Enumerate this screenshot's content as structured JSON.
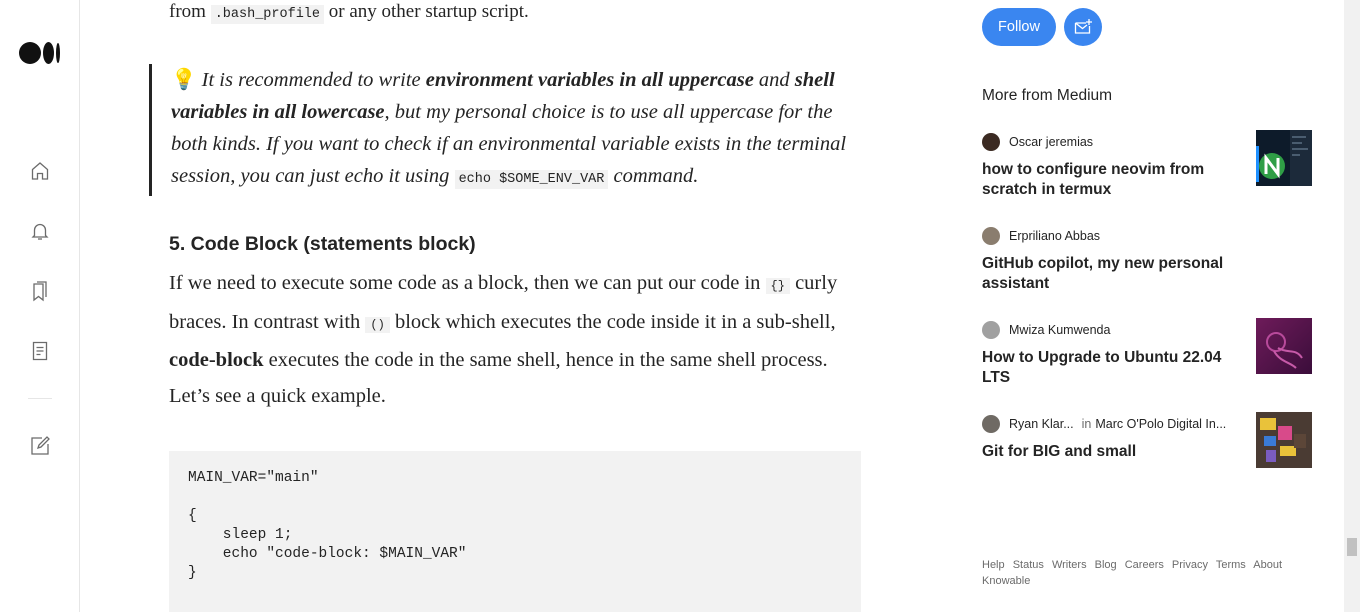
{
  "article": {
    "p_top_before": "from ",
    "p_top_code": ".bash_profile",
    "p_top_after": " or any other startup script.",
    "quote": {
      "bulb": "💡",
      "t1": " It is recommended to write ",
      "b1": "environment variables in all uppercase",
      "t2": " and ",
      "b2": "shell variables in all lowercase",
      "t3": ", but my personal choice is to use all uppercase for the both kinds. If you want to check if an environmental variable exists in the terminal session, you can just echo it using ",
      "code": "echo $SOME_ENV_VAR",
      "t4": " command."
    },
    "heading": "5. Code Block (statements block)",
    "para": {
      "t1": "If we need to execute some code as a block, then we can put our code in ",
      "c1": "{}",
      "t2": " curly braces. In contrast with ",
      "c2": "()",
      "t3": " block which executes the code inside it in a sub-shell, ",
      "b1": "code-block",
      "t4": " executes the code in the same shell, hence in the same shell process. Let’s see a quick example."
    },
    "code_block": "MAIN_VAR=\"main\"\n\n{\n    sleep 1;\n    echo \"code-block: $MAIN_VAR\"\n}"
  },
  "sidebar": {
    "follow_label": "Follow",
    "more_title": "More from Medium",
    "items": [
      {
        "author": "Oscar jeremias",
        "publication": "",
        "title": "how to configure neovim from scratch in termux",
        "avatar_color": "#5a3b2e",
        "thumb": "neovim"
      },
      {
        "author": "Erpriliano Abbas",
        "publication": "",
        "title": "GitHub copilot, my new personal assistant",
        "avatar_color": "#8a7d6e",
        "thumb": ""
      },
      {
        "author": "Mwiza Kumwenda",
        "publication": "",
        "title": "How to Upgrade to Ubuntu 22.04 LTS",
        "avatar_color": "#9a9a9a",
        "thumb": "ubuntu"
      },
      {
        "author": "Ryan Klar...",
        "in": "in",
        "publication": "Marc O'Polo Digital In...",
        "title": "Git for BIG and small",
        "avatar_color": "#6f6a64",
        "thumb": "lego"
      }
    ],
    "footer_links": [
      "Help",
      "Status",
      "Writers",
      "Blog",
      "Careers",
      "Privacy",
      "Terms",
      "About",
      "Knowable"
    ]
  },
  "colors": {
    "accent": "#3a86f0",
    "text": "#242424",
    "muted": "#6b6b6b",
    "code_bg": "#f2f2f2"
  }
}
